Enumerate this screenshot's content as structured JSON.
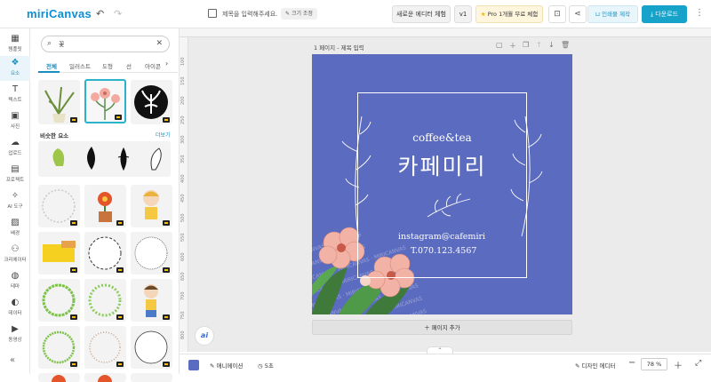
{
  "header": {
    "logo": "miriCanvas",
    "doc_title_placeholder": "제목을 입력해주세요.",
    "resize_label": "크기 조정",
    "new_editor_label": "새로운 에디터 체험",
    "version_label": "v1",
    "pro_label": "Pro 1개월 무료 체험",
    "print_label": "인쇄물 제작",
    "download_label": "다운로드"
  },
  "sidebar": {
    "items": [
      {
        "label": "템플릿",
        "icon": "layout-icon"
      },
      {
        "label": "요소",
        "icon": "shapes-icon"
      },
      {
        "label": "텍스트",
        "icon": "text-icon"
      },
      {
        "label": "사진",
        "icon": "image-icon"
      },
      {
        "label": "업로드",
        "icon": "upload-icon"
      },
      {
        "label": "프로젝트",
        "icon": "folder-icon"
      },
      {
        "label": "AI 도구",
        "icon": "sparkle-icon"
      },
      {
        "label": "배경",
        "icon": "background-icon"
      },
      {
        "label": "크리에이터",
        "icon": "creator-icon"
      },
      {
        "label": "테마",
        "icon": "palette-icon"
      },
      {
        "label": "데이터",
        "icon": "data-icon"
      },
      {
        "label": "동영상",
        "icon": "video-icon"
      }
    ],
    "active_index": 1
  },
  "panel": {
    "search_value": "꽃",
    "tabs": [
      "전체",
      "일러스트",
      "도형",
      "선",
      "아이콘"
    ],
    "active_tab": 0,
    "similar_title": "비슷한 요소",
    "similar_more": "더보기"
  },
  "page": {
    "label": "1 페이지 - 제목 입력",
    "add_page": "페이지 추가"
  },
  "design": {
    "small_title": "coffee&tea",
    "big_title": "카페미리",
    "instagram": "instagram@cafemiri",
    "tel": "T.070.123.4567",
    "background_color": "#5b6bbf",
    "watermark": "MIRICANVAS"
  },
  "bottombar": {
    "animation_label": "애니메이션",
    "timer_label": "5초",
    "design_editor_label": "디자인 에디터",
    "zoom_value": "78",
    "zoom_unit": "%"
  },
  "ruler": {
    "marks": [
      "100",
      "150",
      "200",
      "250",
      "300",
      "350",
      "400",
      "450",
      "500",
      "550",
      "600",
      "650",
      "700",
      "750",
      "800"
    ]
  },
  "ai_button": "ai"
}
